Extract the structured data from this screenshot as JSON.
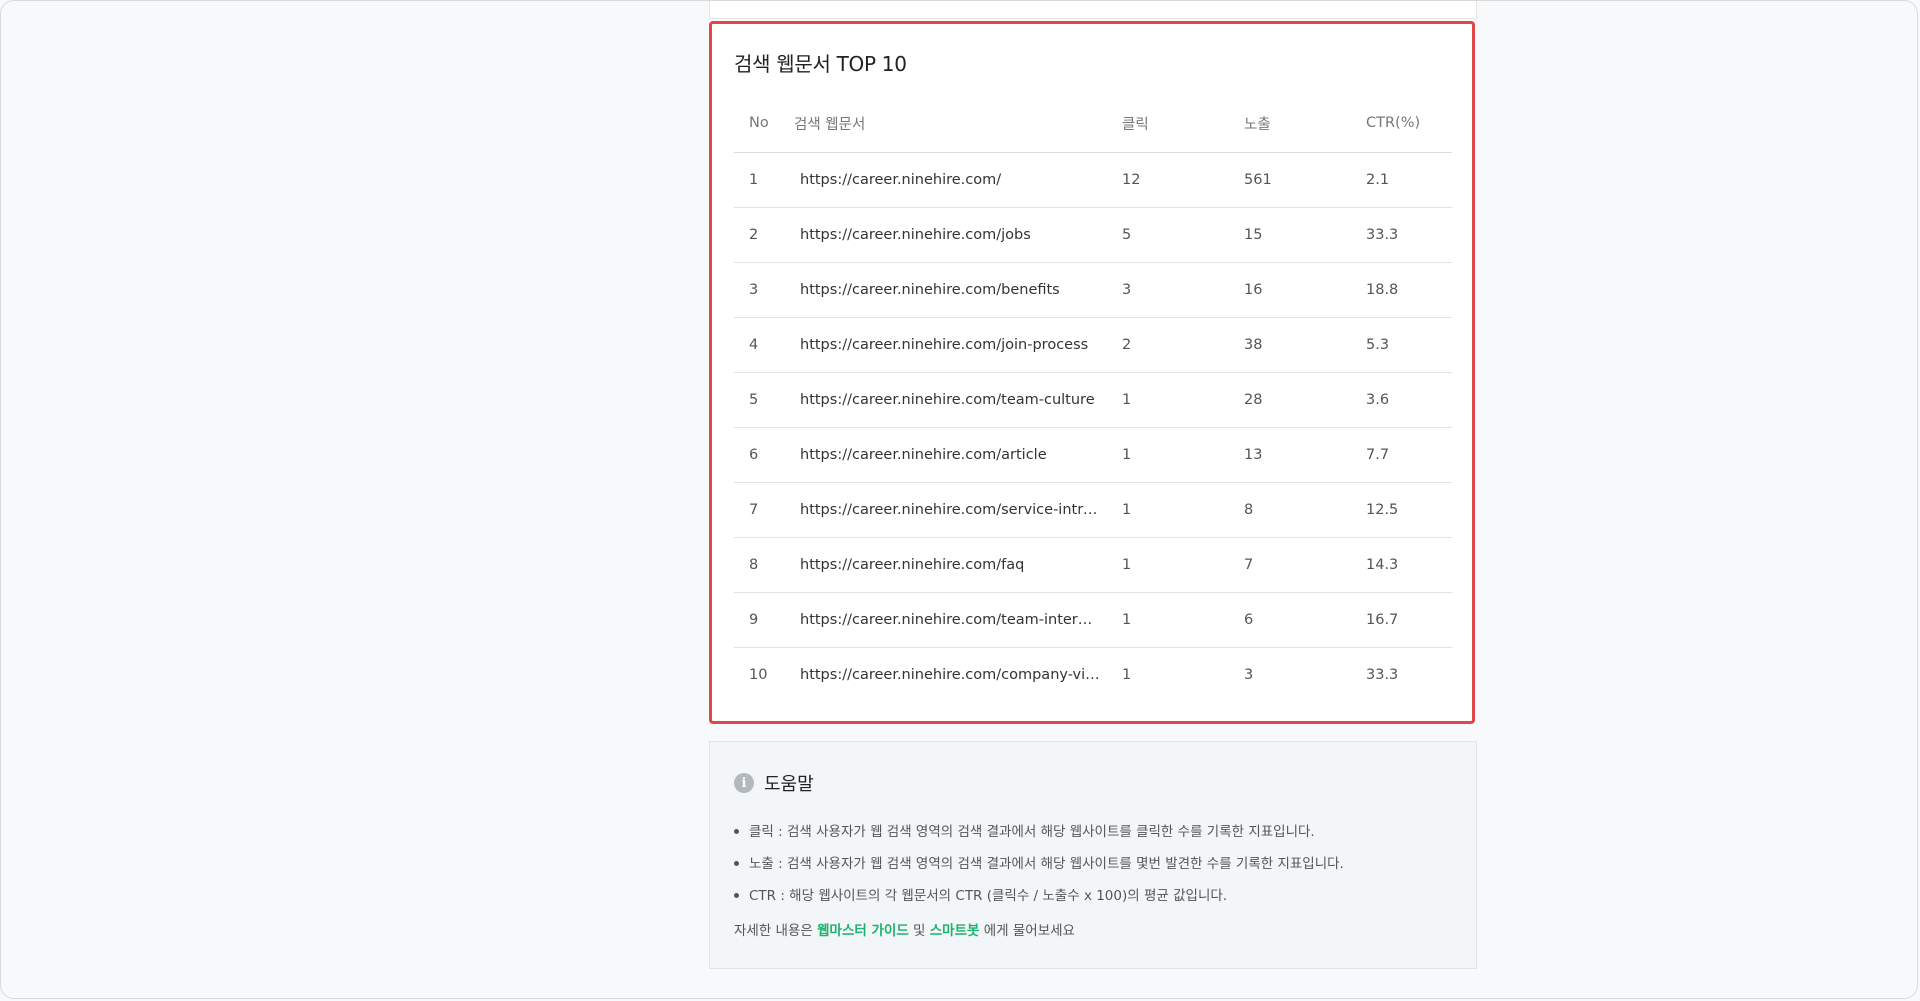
{
  "top_docs": {
    "title": "검색 웹문서 TOP 10",
    "columns": [
      "No",
      "검색 웹문서",
      "클릭",
      "노출",
      "CTR(%)"
    ],
    "rows": [
      {
        "no": "1",
        "url": "https://career.ninehire.com/",
        "clicks": "12",
        "impressions": "561",
        "ctr": "2.1"
      },
      {
        "no": "2",
        "url": "https://career.ninehire.com/jobs",
        "clicks": "5",
        "impressions": "15",
        "ctr": "33.3"
      },
      {
        "no": "3",
        "url": "https://career.ninehire.com/benefits",
        "clicks": "3",
        "impressions": "16",
        "ctr": "18.8"
      },
      {
        "no": "4",
        "url": "https://career.ninehire.com/join-process",
        "clicks": "2",
        "impressions": "38",
        "ctr": "5.3"
      },
      {
        "no": "5",
        "url": "https://career.ninehire.com/team-culture",
        "clicks": "1",
        "impressions": "28",
        "ctr": "3.6"
      },
      {
        "no": "6",
        "url": "https://career.ninehire.com/article",
        "clicks": "1",
        "impressions": "13",
        "ctr": "7.7"
      },
      {
        "no": "7",
        "url": "https://career.ninehire.com/service-introdu...",
        "clicks": "1",
        "impressions": "8",
        "ctr": "12.5"
      },
      {
        "no": "8",
        "url": "https://career.ninehire.com/faq",
        "clicks": "1",
        "impressions": "7",
        "ctr": "14.3"
      },
      {
        "no": "9",
        "url": "https://career.ninehire.com/team-interview",
        "clicks": "1",
        "impressions": "6",
        "ctr": "16.7"
      },
      {
        "no": "10",
        "url": "https://career.ninehire.com/company-vision",
        "clicks": "1",
        "impressions": "3",
        "ctr": "33.3"
      }
    ],
    "highlight_color": "#e0474c"
  },
  "help": {
    "icon": "info-icon",
    "title": "도움말",
    "items": [
      "클릭 : 검색 사용자가 웹 검색 영역의 검색 결과에서 해당 웹사이트를 클릭한 수를 기록한 지표입니다.",
      "노출 : 검색 사용자가 웹 검색 영역의 검색 결과에서 해당 웹사이트를 몇번 발견한 수를 기록한 지표입니다.",
      "CTR : 해당 웹사이트의 각 웹문서의 CTR (클릭수 / 노출수 x 100)의 평균 값입니다."
    ],
    "footer_prefix": "자세한 내용은",
    "link_guide": "웹마스터 가이드",
    "conjunction": "및",
    "link_bot": "스마트봇",
    "footer_suffix": "에게 물어보세요",
    "link_color": "#19b36b"
  }
}
